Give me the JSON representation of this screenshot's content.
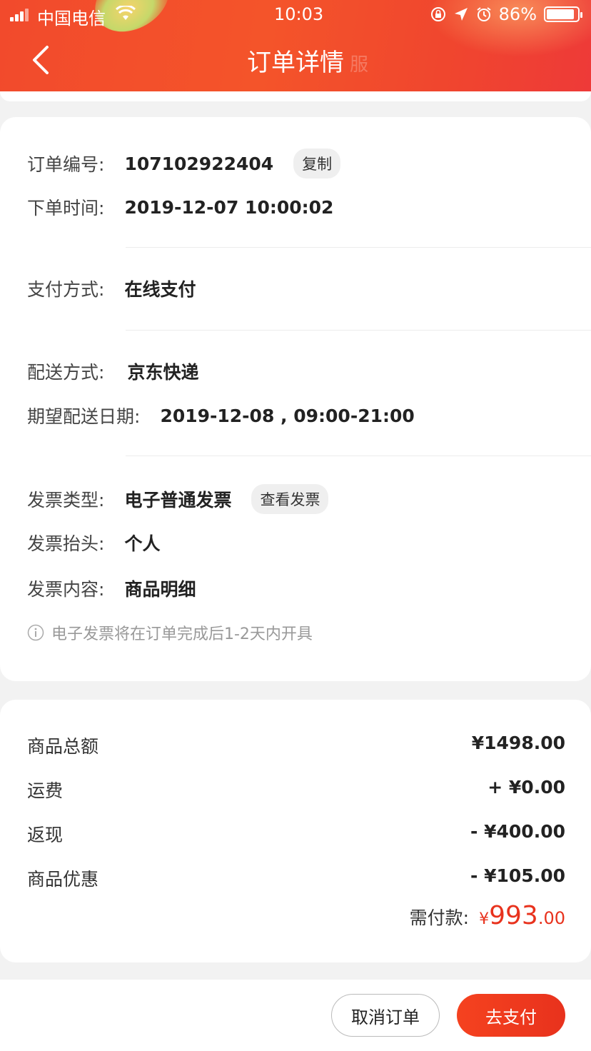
{
  "status_bar": {
    "carrier": "中国电信",
    "time": "10:03",
    "battery": "86%",
    "icons": [
      "signal-icon",
      "wifi-icon",
      "orientation-lock-icon",
      "location-icon",
      "alarm-icon",
      "battery-icon"
    ]
  },
  "header": {
    "title": "订单详情",
    "back_icon": "chevron-left-icon",
    "ghost_text": "服"
  },
  "order": {
    "number_label": "订单编号:",
    "number": "107102922404",
    "copy_label": "复制",
    "time_label": "下单时间:",
    "time": "2019-12-07 10:00:02",
    "pay_method_label": "支付方式:",
    "pay_method": "在线支付",
    "delivery_label": "配送方式:",
    "delivery": "京东快递",
    "expected_label": "期望配送日期:",
    "expected": "2019-12-08 , 09:00-21:00",
    "invoice_type_label": "发票类型:",
    "invoice_type": "电子普通发票",
    "view_invoice_label": "查看发票",
    "invoice_title_label": "发票抬头:",
    "invoice_title": "个人",
    "invoice_content_label": "发票内容:",
    "invoice_content": "商品明细",
    "invoice_note": "电子发票将在订单完成后1-2天内开具"
  },
  "summary": {
    "items": [
      {
        "label": "商品总额",
        "value": "¥1498.00"
      },
      {
        "label": "运费",
        "value": "+ ¥0.00"
      },
      {
        "label": "返现",
        "value": "- ¥400.00"
      },
      {
        "label": "商品优惠",
        "value": "- ¥105.00"
      }
    ],
    "total_label": "需付款:",
    "total_currency": "¥",
    "total_int": "993",
    "total_dec": ".00"
  },
  "actions": {
    "cancel": "取消订单",
    "pay": "去支付"
  },
  "colors": {
    "accent": "#e8321d",
    "header": "#f24a2c"
  }
}
